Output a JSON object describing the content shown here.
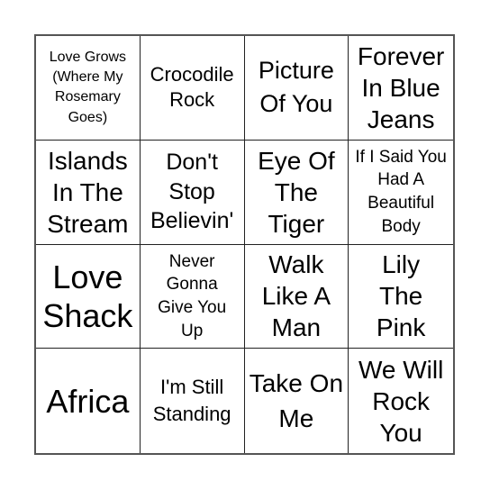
{
  "bingo_card": {
    "rows": [
      [
        {
          "text": "Love Grows (Where My Rosemary Goes)"
        },
        {
          "text": "Crocodile Rock"
        },
        {
          "text": "Picture Of You"
        },
        {
          "text": "Forever In Blue Jeans"
        }
      ],
      [
        {
          "text": "Islands In The Stream"
        },
        {
          "text": "Don't Stop Believin'"
        },
        {
          "text": "Eye Of The Tiger"
        },
        {
          "text": "If I Said You Had A Beautiful Body"
        }
      ],
      [
        {
          "text": "Love Shack"
        },
        {
          "text": "Never Gonna Give You Up"
        },
        {
          "text": "Walk Like A Man"
        },
        {
          "text": "Lily The Pink"
        }
      ],
      [
        {
          "text": "Africa"
        },
        {
          "text": "I'm Still Standing"
        },
        {
          "text": "Take On Me"
        },
        {
          "text": "We Will Rock You"
        }
      ]
    ]
  }
}
